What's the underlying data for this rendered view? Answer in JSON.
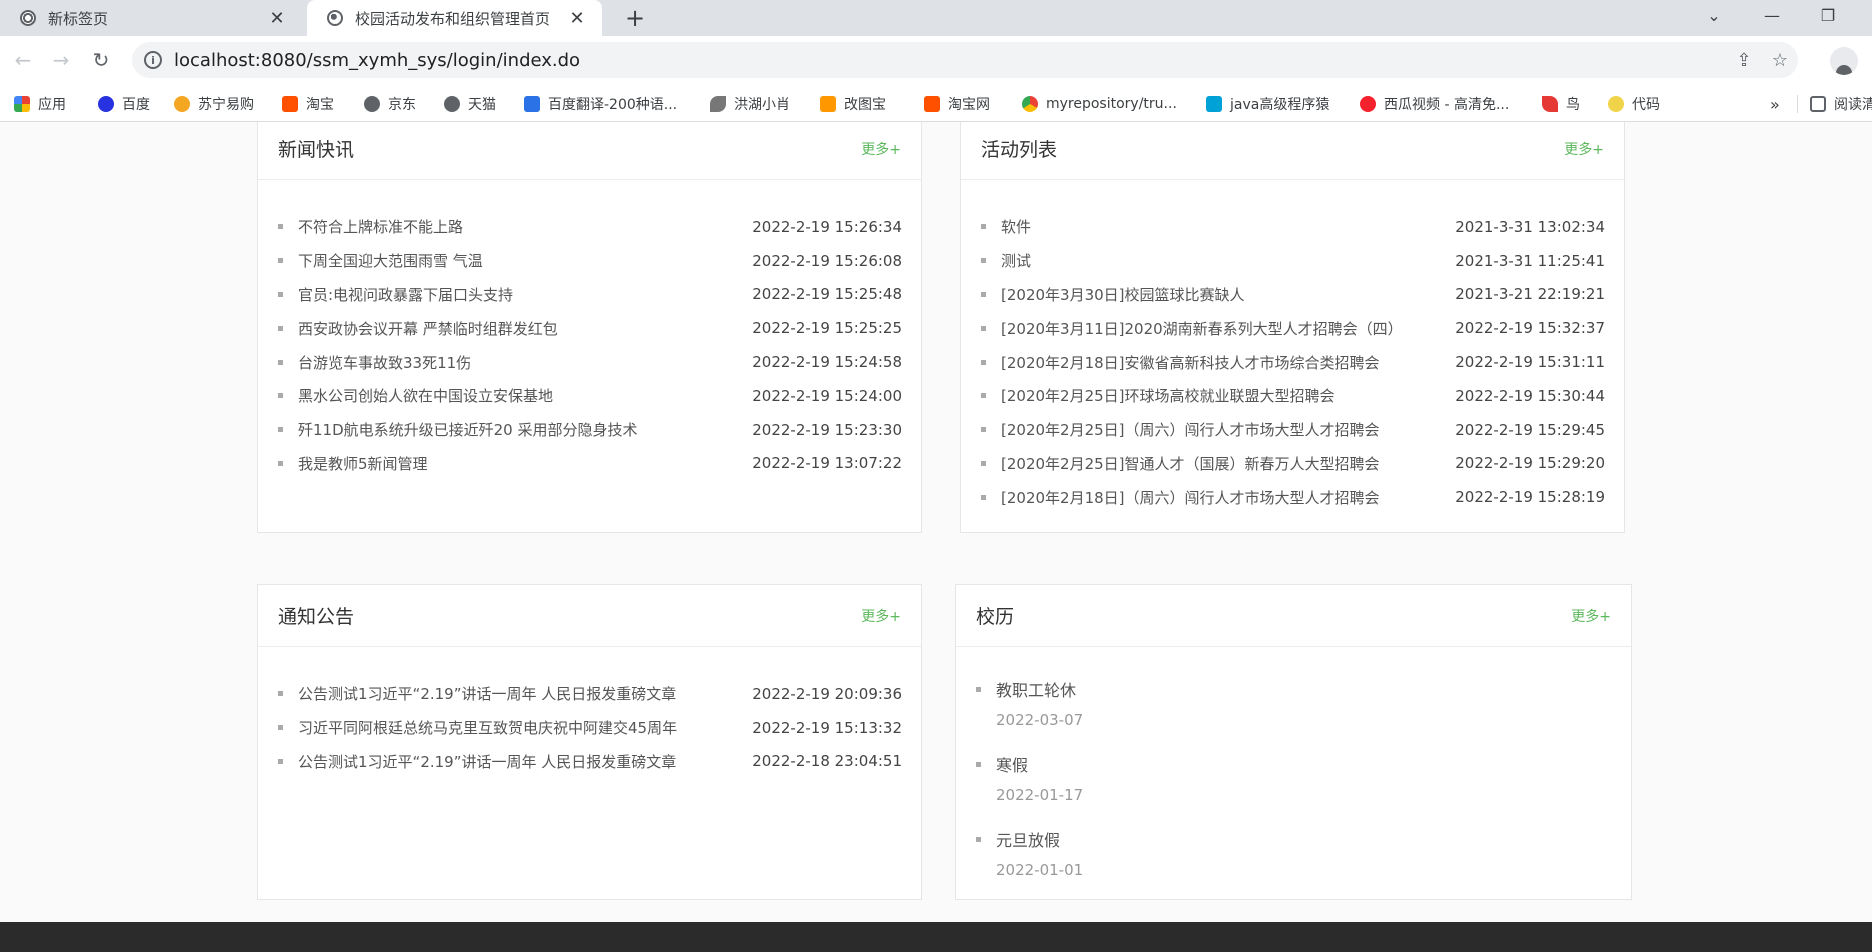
{
  "browser": {
    "tabs": [
      {
        "title": "新标签页",
        "active": false
      },
      {
        "title": "校园活动发布和组织管理首页",
        "active": true
      }
    ],
    "new_tab": "+",
    "url": "localhost:8080/ssm_xymh_sys/login/index.do",
    "bookmarks": [
      {
        "label": "应用",
        "icon": "apps-grid-icon",
        "color": "#ea4335"
      },
      {
        "label": "百度",
        "icon": "baidu-icon",
        "color": "#2932e1"
      },
      {
        "label": "苏宁易购",
        "icon": "suning-icon",
        "color": "#f5a623"
      },
      {
        "label": "淘宝",
        "icon": "taobao-icon",
        "color": "#ff5000"
      },
      {
        "label": "京东",
        "icon": "globe-icon",
        "color": "#5f6368"
      },
      {
        "label": "天猫",
        "icon": "globe-icon",
        "color": "#5f6368"
      },
      {
        "label": "百度翻译-200种语...",
        "icon": "translate-icon",
        "color": "#2b72e6"
      },
      {
        "label": "洪湖小肖",
        "icon": "bird-icon",
        "color": "#555555"
      },
      {
        "label": "改图宝",
        "icon": "gaitubao-icon",
        "color": "#ff9800"
      },
      {
        "label": "淘宝网",
        "icon": "taobao-icon",
        "color": "#ff5000"
      },
      {
        "label": "myrepository/tru...",
        "icon": "chrome-icon",
        "color": "#34a853"
      },
      {
        "label": "java高级程序猿",
        "icon": "bilibili-icon",
        "color": "#00a1d6"
      },
      {
        "label": "西瓜视频 - 高清免...",
        "icon": "xigua-icon",
        "color": "#f5222d"
      },
      {
        "label": "鸟",
        "icon": "red-bird-icon",
        "color": "#e53935"
      },
      {
        "label": "代码",
        "icon": "leaf-icon",
        "color": "#f1d34a"
      }
    ],
    "bookmarks_more": "»",
    "reading_list": "阅读清"
  },
  "news": {
    "title": "新闻快讯",
    "more": "更多+",
    "items": [
      {
        "text": "不符合上牌标准不能上路",
        "date": "2022-2-19 15:26:34"
      },
      {
        "text": "下周全国迎大范围雨雪 气温",
        "date": "2022-2-19 15:26:08"
      },
      {
        "text": "官员:电视问政暴露下届口头支持",
        "date": "2022-2-19 15:25:48"
      },
      {
        "text": "西安政协会议开幕 严禁临时组群发红包",
        "date": "2022-2-19 15:25:25"
      },
      {
        "text": "台游览车事故致33死11伤",
        "date": "2022-2-19 15:24:58"
      },
      {
        "text": "黑水公司创始人欲在中国设立安保基地",
        "date": "2022-2-19 15:24:00"
      },
      {
        "text": "歼11D航电系统升级已接近歼20 采用部分隐身技术",
        "date": "2022-2-19 15:23:30"
      },
      {
        "text": "我是教师5新闻管理",
        "date": "2022-2-19 13:07:22"
      }
    ]
  },
  "activities": {
    "title": "活动列表",
    "more": "更多+",
    "items": [
      {
        "text": "软件",
        "date": "2021-3-31 13:02:34"
      },
      {
        "text": "测试",
        "date": "2021-3-31 11:25:41"
      },
      {
        "text": "[2020年3月30日]校园篮球比赛缺人",
        "date": "2021-3-21 22:19:21"
      },
      {
        "text": "[2020年3月11日]2020湖南新春系列大型人才招聘会（四）",
        "date": "2022-2-19 15:32:37"
      },
      {
        "text": "[2020年2月18日]安徽省高新科技人才市场综合类招聘会",
        "date": "2022-2-19 15:31:11"
      },
      {
        "text": "[2020年2月25日]环球场高校就业联盟大型招聘会",
        "date": "2022-2-19 15:30:44"
      },
      {
        "text": "[2020年2月25日]（周六）闯行人才市场大型人才招聘会",
        "date": "2022-2-19 15:29:45"
      },
      {
        "text": "[2020年2月25日]智通人才（国展）新春万人大型招聘会",
        "date": "2022-2-19 15:29:20"
      },
      {
        "text": "[2020年2月18日]（周六）闯行人才市场大型人才招聘会",
        "date": "2022-2-19 15:28:19"
      }
    ]
  },
  "notices": {
    "title": "通知公告",
    "more": "更多+",
    "items": [
      {
        "text": "公告测试1习近平“2.19”讲话一周年 人民日报发重磅文章",
        "date": "2022-2-19 20:09:36"
      },
      {
        "text": "习近平同阿根廷总统马克里互致贺电庆祝中阿建交45周年",
        "date": "2022-2-19 15:13:32"
      },
      {
        "text": "公告测试1习近平“2.19”讲话一周年 人民日报发重磅文章",
        "date": "2022-2-18 23:04:51"
      }
    ]
  },
  "calendar": {
    "title": "校历",
    "more": "更多+",
    "items": [
      {
        "text": "教职工轮休",
        "date": "2022-03-07"
      },
      {
        "text": "寒假",
        "date": "2022-01-17"
      },
      {
        "text": "元旦放假",
        "date": "2022-01-01"
      }
    ]
  },
  "colors": {
    "accent": "#5cb85c",
    "footer": "#2b2b2b"
  }
}
